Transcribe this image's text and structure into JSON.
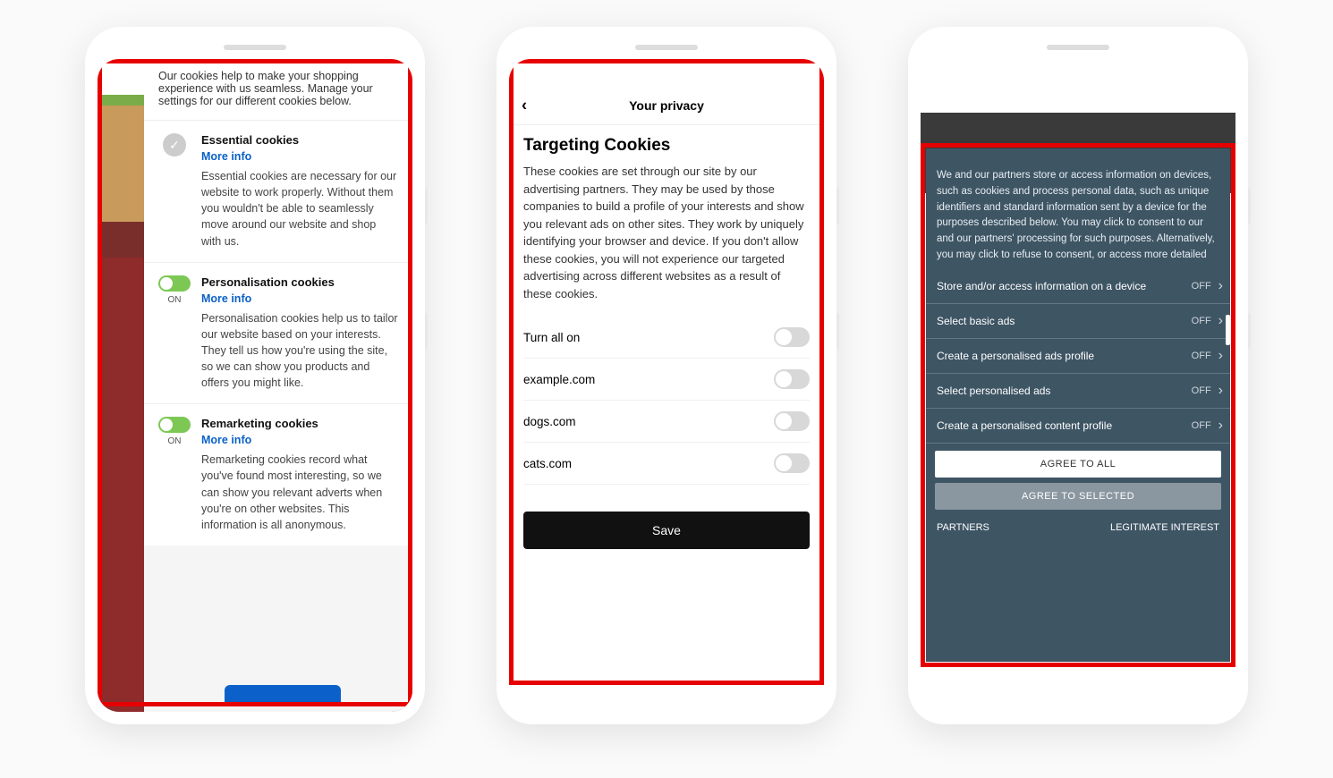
{
  "phone1": {
    "intro": "Our cookies help to make your shopping experience with us seamless. Manage your settings for our different cookies below.",
    "on_label": "ON",
    "sections": [
      {
        "title": "Essential cookies",
        "more": "More info",
        "desc": "Essential cookies are necessary for our website to work properly. Without them you wouldn't be able to seamlessly move around our website and shop with us."
      },
      {
        "title": "Personalisation cookies",
        "more": "More info",
        "desc": "Personalisation cookies help us to tailor our website based on your interests. They tell us how you're using the site, so we can show you products and offers you might like."
      },
      {
        "title": "Remarketing cookies",
        "more": "More info",
        "desc": "Remarketing cookies record what you've found most interesting, so we can show you relevant adverts when you're on other websites. This information is all anonymous."
      }
    ]
  },
  "phone2": {
    "header": "Your privacy",
    "title": "Targeting Cookies",
    "desc": "These cookies are set through our site by our advertising partners. They may be used by those companies to build a profile of your interests and show you relevant ads on other sites. They work by uniquely identifying your browser and device. If you don't allow these cookies, you will not experience our targeted advertising across different websites as a result of these cookies.",
    "turn_all": "Turn all on",
    "items": [
      "example.com",
      "dogs.com",
      "cats.com"
    ],
    "save": "Save"
  },
  "phone3": {
    "body": "We and our partners store or access information on devices, such as cookies and process personal data, such as unique identifiers and standard information sent by a device for the purposes described below. You may click to consent to our and our partners' processing for such purposes. Alternatively, you may click to refuse to consent, or access more detailed",
    "off": "OFF",
    "items": [
      "Store and/or access information on a device",
      "Select basic ads",
      "Create a personalised ads profile",
      "Select personalised ads",
      "Create a personalised content profile"
    ],
    "agree_all": "AGREE TO ALL",
    "agree_selected": "AGREE TO SELECTED",
    "partners": "PARTNERS",
    "legit": "LEGITIMATE INTEREST"
  }
}
